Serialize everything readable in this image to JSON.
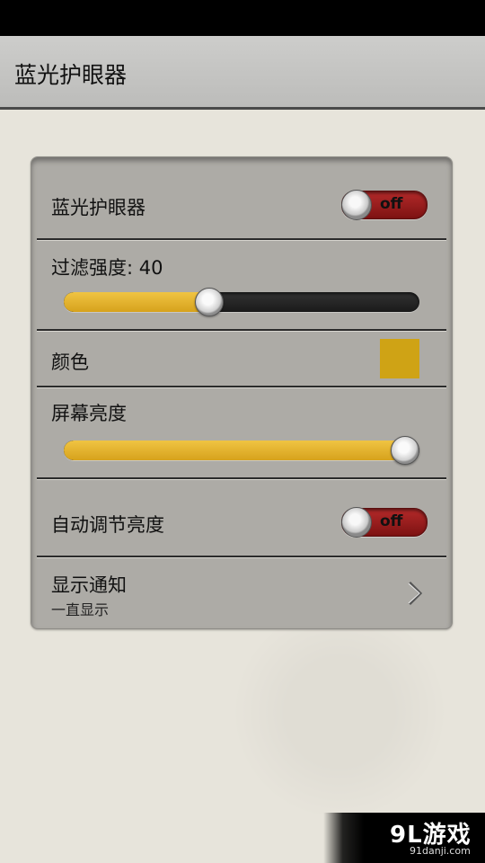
{
  "app": {
    "title": "蓝光护眼器"
  },
  "settings": {
    "blue_filter": {
      "label": "蓝光护眼器",
      "toggle_text": "off",
      "enabled": false
    },
    "filter_strength": {
      "label": "过滤强度: 40",
      "value": 40,
      "max": 100
    },
    "color": {
      "label": "颜色",
      "swatch_color": "#cfa315"
    },
    "brightness": {
      "label": "屏幕亮度",
      "value": 100,
      "max": 100
    },
    "auto_brightness": {
      "label": "自动调节亮度",
      "toggle_text": "off",
      "enabled": false
    },
    "notification": {
      "label": "显示通知",
      "value": "一直显示",
      "icon": "chevron-right-icon"
    }
  },
  "colors": {
    "accent_fill": "#e2b12e",
    "toggle_off": "#9e1f1f"
  },
  "watermark": {
    "logo": "9L游戏",
    "url": "91danji.com"
  }
}
